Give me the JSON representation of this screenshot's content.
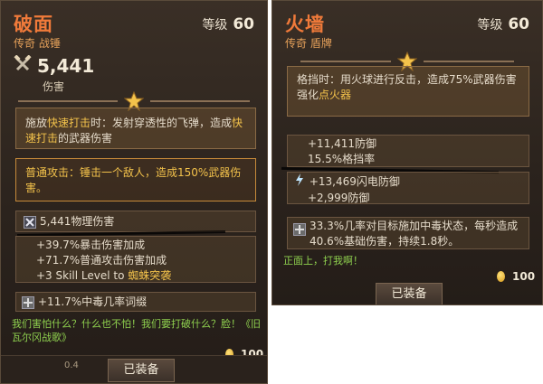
{
  "left_card": {
    "name": "破面",
    "rarity_type": "传奇 战锤",
    "level_label": "等级",
    "level_value": "60",
    "damage_value": "5,441",
    "damage_label": "伤害",
    "skill_box": {
      "pre": "施放",
      "skill1": "快速打击",
      "mid": "时：发射穿透性的飞弹，造成",
      "skill2": "快速打击",
      "post": "的武器伤害"
    },
    "normal_attack": "普通攻击：锤击一个敌人，造成150%武器伤害。",
    "physical": "5,441物理伤害",
    "stats": [
      "+39.7%暴击伤害加成",
      "+71.7%普通攻击伤害加成"
    ],
    "skill_level_pre": "+3 Skill Level to ",
    "skill_level_name": "蜘蛛突袭",
    "poison": "+11.7%中毒几率词缀",
    "flavor": "我们害怕什么？什么也不怕！我们要打破什么？脸！《旧瓦尔冈战歌》",
    "ghost_text": "0.4",
    "gold": "100",
    "equip_label": "已装备"
  },
  "right_card": {
    "name": "火墙",
    "rarity_type": "传奇 盾牌",
    "level_label": "等级",
    "level_value": "60",
    "block_text": "格挡时：用火球进行反击，造成75%武器伤害",
    "enhance_pre": "强化",
    "enhance_name": "点火器",
    "defense": "+11,411防御",
    "block_rate": "15.5%格挡率",
    "lightning": "+13,469闪电防御",
    "defense2": "+2,999防御",
    "poison_text": "33.3%几率对目标施加中毒状态，每秒造成40.6%基础伤害，持续1.8秒。",
    "flavor": "正面上，打我啊！",
    "gold": "100",
    "equip_label": "已装备"
  },
  "colors": {
    "name_orange": "#f07a3a",
    "highlight_gold": "#f3c24b",
    "flavor_green": "#8fd14f"
  }
}
